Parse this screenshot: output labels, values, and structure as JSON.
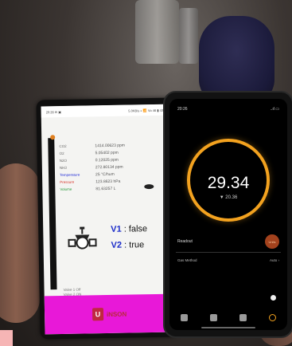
{
  "android": {
    "status_left": "20:26 ✉ ▣",
    "status_right": "5.0KB/s ◐ 📶 Vo 46 ▮ 43%",
    "readings": [
      {
        "label": "CO2",
        "value": "1414.00623 ppm",
        "label_color": "#666666"
      },
      {
        "label": "O2",
        "value": "5.05402 ppm",
        "label_color": "#666666"
      },
      {
        "label": "N2O",
        "value": "0.12025 ppm",
        "label_color": "#666666"
      },
      {
        "label": "NH3",
        "value": "272.80134 ppm",
        "label_color": "#666666"
      },
      {
        "label": "Temperature",
        "value": "25 °C/hum",
        "label_color": "#2b35d8"
      },
      {
        "label": "Pressure",
        "value": "123.8623 hPa",
        "label_color": "#d8352b"
      },
      {
        "label": "Volume",
        "value": "81.63257 L",
        "label_color": "#2c9a3c"
      }
    ],
    "v1_key": "V1",
    "v1_value": ": false",
    "v2_key": "V2",
    "v2_value": ": true",
    "footer_line1": "Valve 1 Off",
    "footer_line2": "Valve 2 ON",
    "logo_badge": "U",
    "logo_text": "iNSON",
    "bar_color": "#e818d8"
  },
  "iphone": {
    "status_time": "20:26",
    "status_right": "..ıl ▭",
    "reading": "29.34",
    "sub_reading": "▼ 20.36",
    "row1_label": "Readout",
    "toggle_label": "Units",
    "row2_label": "Gas Method",
    "row2_value": "Auto ›",
    "accent": "#f3a21f"
  }
}
